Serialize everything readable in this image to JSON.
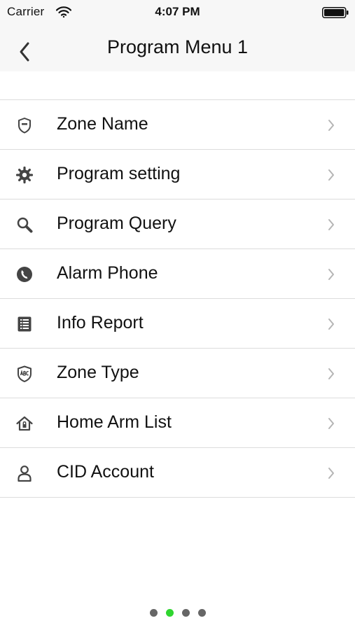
{
  "status_bar": {
    "carrier": "Carrier",
    "time": "4:07 PM"
  },
  "nav": {
    "title": "Program Menu 1",
    "back_icon": "chevron-left-icon"
  },
  "menu": {
    "items": [
      {
        "label": "Zone Name",
        "icon": "shield-icon"
      },
      {
        "label": "Program setting",
        "icon": "gear-icon"
      },
      {
        "label": "Program Query",
        "icon": "search-icon"
      },
      {
        "label": "Alarm Phone",
        "icon": "phone-icon"
      },
      {
        "label": "Info Report",
        "icon": "list-icon"
      },
      {
        "label": "Zone Type",
        "icon": "abc-shield-icon"
      },
      {
        "label": "Home Arm List",
        "icon": "home-icon"
      },
      {
        "label": "CID Account",
        "icon": "user-icon"
      }
    ]
  },
  "pager": {
    "count": 4,
    "active_index": 1,
    "active_color": "#2fd52f",
    "inactive_color": "#666666"
  }
}
